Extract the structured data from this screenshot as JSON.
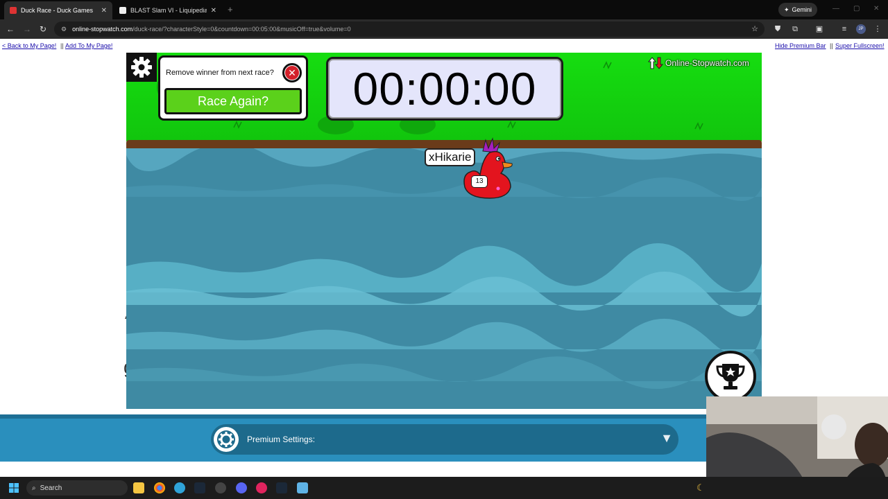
{
  "browser": {
    "tabs": [
      {
        "title": "Duck Race - Duck Games",
        "active": true
      },
      {
        "title": "BLAST Slam VI - Liquipedia Dot",
        "active": false
      }
    ],
    "gemini_label": "Gemini",
    "url_host": "online-stopwatch.com",
    "url_path": "/duck-race/?characterStyle=0&countdown=00:05:00&musicOff=true&volume=0",
    "profile_initials": "JP"
  },
  "page": {
    "back_link": "< Back to My Page!",
    "separator": "||",
    "add_link": "Add To My Page!",
    "hide_premium": "Hide Premium Bar",
    "super_fullscreen": "Super Fullscreen!",
    "ghost_text_1": "AY",
    "ghost_text_2": "g"
  },
  "game": {
    "remove_winner_label": "Remove winner from next race?",
    "race_again_label": "Race Again?",
    "timer": "00:00:00",
    "brand": "Online-Stopwatch.com",
    "player_name": "xHikarie",
    "duck_number": "13",
    "colors": {
      "grass": "#16dd10",
      "water": "#3f8aa3",
      "duck": "#e3141e",
      "race_button": "#5bd11b"
    }
  },
  "premium": {
    "label": "Premium Settings:"
  },
  "taskbar": {
    "search_placeholder": "Search"
  }
}
